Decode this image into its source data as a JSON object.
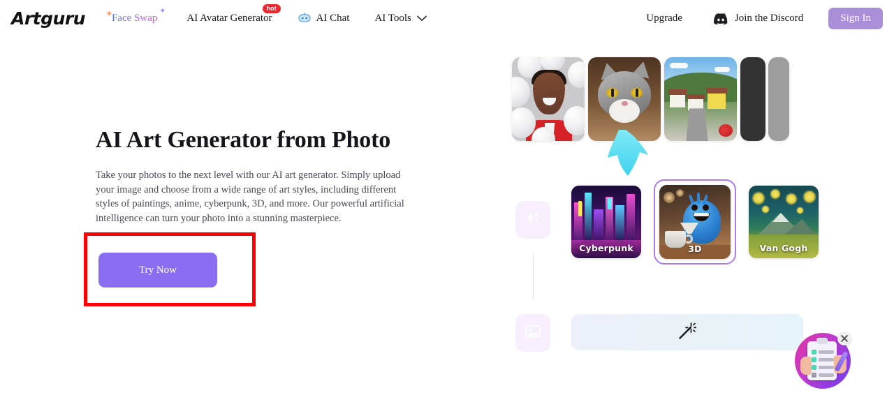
{
  "brand": {
    "name": "Artguru"
  },
  "nav": {
    "items": [
      {
        "label": "Face Swap",
        "icon": "sparkle-icon",
        "badge": null
      },
      {
        "label": "AI Avatar Generator",
        "icon": null,
        "badge": "hot"
      },
      {
        "label": "AI Chat",
        "icon": "chat-robot-icon",
        "badge": null
      },
      {
        "label": "AI Tools",
        "icon": "chevron-down-icon",
        "badge": null
      }
    ],
    "upgrade_label": "Upgrade",
    "discord_label": "Join the Discord",
    "discord_icon": "discord-icon",
    "signin_label": "Sign In"
  },
  "hero": {
    "title": "AI Art Generator from Photo",
    "description": "Take your photos to the next level with our AI art generator. Simply upload your image and choose from a wide range of art styles, including different styles of paintings, anime, cyberpunk, 3D, and more. Our powerful artificial intelligence can turn your photo into a stunning masterpiece.",
    "cta_label": "Try Now"
  },
  "showcase": {
    "thumbnails": [
      {
        "name": "man-with-balloons-photo"
      },
      {
        "name": "cat-photo"
      },
      {
        "name": "town-landscape-photo"
      },
      {
        "name": "dark-placeholder-card"
      },
      {
        "name": "gray-placeholder-card"
      }
    ],
    "arrow_icon": "arrow-down-icon",
    "rail": [
      {
        "icon": "sparkles-icon"
      },
      {
        "icon": "image-icon"
      }
    ],
    "styles": [
      {
        "label": "Cyberpunk",
        "selected": false
      },
      {
        "label": "3D",
        "selected": true
      },
      {
        "label": "Van Gogh",
        "selected": false
      }
    ],
    "prompt_bar_icon": "magic-wand-icon"
  },
  "survey_widget": {
    "name": "survey-clipboard-widget",
    "close_label": "✕"
  },
  "colors": {
    "accent_purple": "#8a6df0",
    "signin_purple": "#a98fd8",
    "highlight_red": "#fe0000",
    "badge_red": "#f1252b",
    "arrow_cyan": "#5fdcf0",
    "selected_border": "#a97bee"
  }
}
